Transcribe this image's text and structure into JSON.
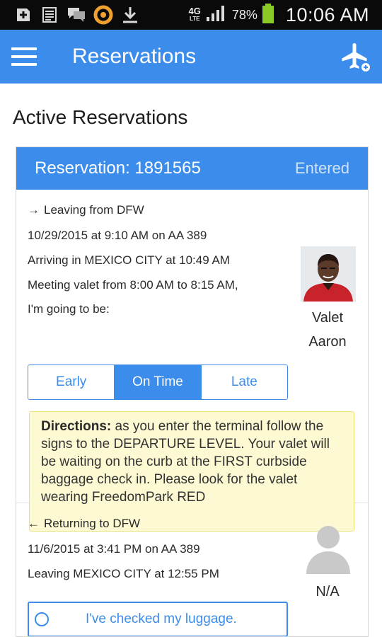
{
  "status_bar": {
    "icons": [
      "add-box-icon",
      "notes-icon",
      "chat-icon",
      "orange-ring-icon",
      "download-icon"
    ],
    "network": "4G",
    "network_sub": "LTE",
    "battery_percent": "78%",
    "time": "10:06 AM"
  },
  "app_bar": {
    "title": "Reservations",
    "menu_icon": "hamburger-menu-icon",
    "action_icon": "add-flight-icon"
  },
  "section_title": "Active Reservations",
  "reservation": {
    "title": "Reservation: 1891565",
    "status": "Entered",
    "departure": {
      "direction_arrow": "→",
      "heading": "Leaving from DFW",
      "flight": "10/29/2015 at 9:10 AM on AA 389",
      "arrival": "Arriving in MEXICO CITY at 10:49 AM",
      "meeting": "Meeting valet from 8:00 AM to 8:15 AM,",
      "prompt": "I'm going to be:",
      "timing_options": [
        "Early",
        "On Time",
        "Late"
      ],
      "selected_timing": "On Time",
      "valet_label": "Valet",
      "valet_name": "Aaron",
      "directions_label": "Directions:",
      "directions_text": "as you enter the terminal follow the signs to the DEPARTURE LEVEL. Your valet will be waiting on the curb at the FIRST curbside baggage check in. Please look for the valet wearing FreedomPark RED"
    },
    "return": {
      "direction_arrow": "←",
      "heading": "Returning to DFW",
      "flight": "11/6/2015 at 3:41 PM on AA 389",
      "leaving": "Leaving MEXICO CITY at 12:55 PM",
      "valet_name": "N/A",
      "luggage_label": "I've checked my luggage."
    }
  },
  "colors": {
    "accent": "#3b8ceb",
    "directions_bg": "#fdf9d3",
    "status_bar": "#0a0a0a"
  }
}
